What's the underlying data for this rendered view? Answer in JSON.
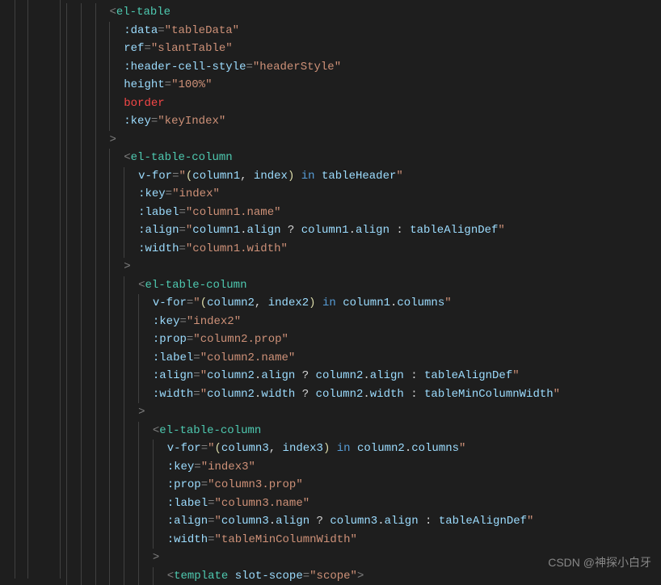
{
  "editor": {
    "watermark": "CSDN @神探小白牙",
    "lines": [
      [
        {
          "t": "ind",
          "n": 3
        },
        {
          "t": "p",
          "v": "<"
        },
        {
          "t": "t",
          "v": "el-table"
        }
      ],
      [
        {
          "t": "ind",
          "n": 4
        },
        {
          "t": "a",
          "v": ":data"
        },
        {
          "t": "p",
          "v": "="
        },
        {
          "t": "s",
          "v": "\"tableData\""
        }
      ],
      [
        {
          "t": "ind",
          "n": 4
        },
        {
          "t": "a",
          "v": "ref"
        },
        {
          "t": "p",
          "v": "="
        },
        {
          "t": "s",
          "v": "\"slantTable\""
        }
      ],
      [
        {
          "t": "ind",
          "n": 4
        },
        {
          "t": "a",
          "v": ":header-cell-style"
        },
        {
          "t": "p",
          "v": "="
        },
        {
          "t": "s",
          "v": "\"headerStyle\""
        }
      ],
      [
        {
          "t": "ind",
          "n": 4
        },
        {
          "t": "a",
          "v": "height"
        },
        {
          "t": "p",
          "v": "="
        },
        {
          "t": "s",
          "v": "\"100%\""
        }
      ],
      [
        {
          "t": "ind",
          "n": 4
        },
        {
          "t": "r",
          "v": "border"
        }
      ],
      [
        {
          "t": "ind",
          "n": 4
        },
        {
          "t": "a",
          "v": ":key"
        },
        {
          "t": "p",
          "v": "="
        },
        {
          "t": "s",
          "v": "\"keyIndex\""
        }
      ],
      [
        {
          "t": "ind",
          "n": 3
        },
        {
          "t": "p",
          "v": ">"
        }
      ],
      [
        {
          "t": "ind",
          "n": 4
        },
        {
          "t": "p",
          "v": "<"
        },
        {
          "t": "t",
          "v": "el-table-column"
        }
      ],
      [
        {
          "t": "ind",
          "n": 5
        },
        {
          "t": "a",
          "v": "v-for"
        },
        {
          "t": "p",
          "v": "="
        },
        {
          "t": "sq",
          "v": "\""
        },
        {
          "t": "y",
          "v": "("
        },
        {
          "t": "v",
          "v": "column1"
        },
        {
          "t": "d",
          "v": ", "
        },
        {
          "t": "v",
          "v": "index"
        },
        {
          "t": "y",
          "v": ")"
        },
        {
          "t": "d",
          "v": " "
        },
        {
          "t": "k",
          "v": "in"
        },
        {
          "t": "d",
          "v": " "
        },
        {
          "t": "v",
          "v": "tableHeader"
        },
        {
          "t": "sq",
          "v": "\""
        }
      ],
      [
        {
          "t": "ind",
          "n": 5
        },
        {
          "t": "a",
          "v": ":key"
        },
        {
          "t": "p",
          "v": "="
        },
        {
          "t": "s",
          "v": "\"index\""
        }
      ],
      [
        {
          "t": "ind",
          "n": 5
        },
        {
          "t": "a",
          "v": ":label"
        },
        {
          "t": "p",
          "v": "="
        },
        {
          "t": "s",
          "v": "\"column1.name\""
        }
      ],
      [
        {
          "t": "ind",
          "n": 5
        },
        {
          "t": "a",
          "v": ":align"
        },
        {
          "t": "p",
          "v": "="
        },
        {
          "t": "sq",
          "v": "\""
        },
        {
          "t": "v",
          "v": "column1"
        },
        {
          "t": "d",
          "v": "."
        },
        {
          "t": "v",
          "v": "align"
        },
        {
          "t": "d",
          "v": " ? "
        },
        {
          "t": "v",
          "v": "column1"
        },
        {
          "t": "d",
          "v": "."
        },
        {
          "t": "v",
          "v": "align"
        },
        {
          "t": "d",
          "v": " : "
        },
        {
          "t": "v",
          "v": "tableAlignDef"
        },
        {
          "t": "sq",
          "v": "\""
        }
      ],
      [
        {
          "t": "ind",
          "n": 5
        },
        {
          "t": "a",
          "v": ":width"
        },
        {
          "t": "p",
          "v": "="
        },
        {
          "t": "s",
          "v": "\"column1.width\""
        }
      ],
      [
        {
          "t": "ind",
          "n": 4
        },
        {
          "t": "p",
          "v": ">"
        }
      ],
      [
        {
          "t": "ind",
          "n": 5
        },
        {
          "t": "p",
          "v": "<"
        },
        {
          "t": "t",
          "v": "el-table-column"
        }
      ],
      [
        {
          "t": "ind",
          "n": 6
        },
        {
          "t": "a",
          "v": "v-for"
        },
        {
          "t": "p",
          "v": "="
        },
        {
          "t": "sq",
          "v": "\""
        },
        {
          "t": "y",
          "v": "("
        },
        {
          "t": "v",
          "v": "column2"
        },
        {
          "t": "d",
          "v": ", "
        },
        {
          "t": "v",
          "v": "index2"
        },
        {
          "t": "y",
          "v": ")"
        },
        {
          "t": "d",
          "v": " "
        },
        {
          "t": "k",
          "v": "in"
        },
        {
          "t": "d",
          "v": " "
        },
        {
          "t": "v",
          "v": "column1"
        },
        {
          "t": "d",
          "v": "."
        },
        {
          "t": "v",
          "v": "columns"
        },
        {
          "t": "sq",
          "v": "\""
        }
      ],
      [
        {
          "t": "ind",
          "n": 6
        },
        {
          "t": "a",
          "v": ":key"
        },
        {
          "t": "p",
          "v": "="
        },
        {
          "t": "s",
          "v": "\"index2\""
        }
      ],
      [
        {
          "t": "ind",
          "n": 6
        },
        {
          "t": "a",
          "v": ":prop"
        },
        {
          "t": "p",
          "v": "="
        },
        {
          "t": "s",
          "v": "\"column2.prop\""
        }
      ],
      [
        {
          "t": "ind",
          "n": 6
        },
        {
          "t": "a",
          "v": ":label"
        },
        {
          "t": "p",
          "v": "="
        },
        {
          "t": "s",
          "v": "\"column2.name\""
        }
      ],
      [
        {
          "t": "ind",
          "n": 6
        },
        {
          "t": "a",
          "v": ":align"
        },
        {
          "t": "p",
          "v": "="
        },
        {
          "t": "sq",
          "v": "\""
        },
        {
          "t": "v",
          "v": "column2"
        },
        {
          "t": "d",
          "v": "."
        },
        {
          "t": "v",
          "v": "align"
        },
        {
          "t": "d",
          "v": " ? "
        },
        {
          "t": "v",
          "v": "column2"
        },
        {
          "t": "d",
          "v": "."
        },
        {
          "t": "v",
          "v": "align"
        },
        {
          "t": "d",
          "v": " : "
        },
        {
          "t": "v",
          "v": "tableAlignDef"
        },
        {
          "t": "sq",
          "v": "\""
        }
      ],
      [
        {
          "t": "ind",
          "n": 6
        },
        {
          "t": "a",
          "v": ":width"
        },
        {
          "t": "p",
          "v": "="
        },
        {
          "t": "sq",
          "v": "\""
        },
        {
          "t": "v",
          "v": "column2"
        },
        {
          "t": "d",
          "v": "."
        },
        {
          "t": "v",
          "v": "width"
        },
        {
          "t": "d",
          "v": " ? "
        },
        {
          "t": "v",
          "v": "column2"
        },
        {
          "t": "d",
          "v": "."
        },
        {
          "t": "v",
          "v": "width"
        },
        {
          "t": "d",
          "v": " : "
        },
        {
          "t": "v",
          "v": "tableMinColumnWidth"
        },
        {
          "t": "sq",
          "v": "\""
        }
      ],
      [
        {
          "t": "ind",
          "n": 5
        },
        {
          "t": "p",
          "v": ">"
        }
      ],
      [
        {
          "t": "ind",
          "n": 6
        },
        {
          "t": "p",
          "v": "<"
        },
        {
          "t": "t",
          "v": "el-table-column"
        }
      ],
      [
        {
          "t": "ind",
          "n": 7
        },
        {
          "t": "a",
          "v": "v-for"
        },
        {
          "t": "p",
          "v": "="
        },
        {
          "t": "sq",
          "v": "\""
        },
        {
          "t": "y",
          "v": "("
        },
        {
          "t": "v",
          "v": "column3"
        },
        {
          "t": "d",
          "v": ", "
        },
        {
          "t": "v",
          "v": "index3"
        },
        {
          "t": "y",
          "v": ")"
        },
        {
          "t": "d",
          "v": " "
        },
        {
          "t": "k",
          "v": "in"
        },
        {
          "t": "d",
          "v": " "
        },
        {
          "t": "v",
          "v": "column2"
        },
        {
          "t": "d",
          "v": "."
        },
        {
          "t": "v",
          "v": "columns"
        },
        {
          "t": "sq",
          "v": "\""
        }
      ],
      [
        {
          "t": "ind",
          "n": 7
        },
        {
          "t": "a",
          "v": ":key"
        },
        {
          "t": "p",
          "v": "="
        },
        {
          "t": "s",
          "v": "\"index3\""
        }
      ],
      [
        {
          "t": "ind",
          "n": 7
        },
        {
          "t": "a",
          "v": ":prop"
        },
        {
          "t": "p",
          "v": "="
        },
        {
          "t": "s",
          "v": "\"column3.prop\""
        }
      ],
      [
        {
          "t": "ind",
          "n": 7
        },
        {
          "t": "a",
          "v": ":label"
        },
        {
          "t": "p",
          "v": "="
        },
        {
          "t": "s",
          "v": "\"column3.name\""
        }
      ],
      [
        {
          "t": "ind",
          "n": 7
        },
        {
          "t": "a",
          "v": ":align"
        },
        {
          "t": "p",
          "v": "="
        },
        {
          "t": "sq",
          "v": "\""
        },
        {
          "t": "v",
          "v": "column3"
        },
        {
          "t": "d",
          "v": "."
        },
        {
          "t": "v",
          "v": "align"
        },
        {
          "t": "d",
          "v": " ? "
        },
        {
          "t": "v",
          "v": "column3"
        },
        {
          "t": "d",
          "v": "."
        },
        {
          "t": "v",
          "v": "align"
        },
        {
          "t": "d",
          "v": " : "
        },
        {
          "t": "v",
          "v": "tableAlignDef"
        },
        {
          "t": "sq",
          "v": "\""
        }
      ],
      [
        {
          "t": "ind",
          "n": 7
        },
        {
          "t": "a",
          "v": ":width"
        },
        {
          "t": "p",
          "v": "="
        },
        {
          "t": "s",
          "v": "\"tableMinColumnWidth\""
        }
      ],
      [
        {
          "t": "ind",
          "n": 6
        },
        {
          "t": "p",
          "v": ">"
        }
      ],
      [
        {
          "t": "ind",
          "n": 7
        },
        {
          "t": "p",
          "v": "<"
        },
        {
          "t": "t",
          "v": "template"
        },
        {
          "t": "d",
          "v": " "
        },
        {
          "t": "a",
          "v": "slot-scope"
        },
        {
          "t": "p",
          "v": "="
        },
        {
          "t": "s",
          "v": "\"scope\""
        },
        {
          "t": "p",
          "v": ">"
        }
      ]
    ]
  }
}
